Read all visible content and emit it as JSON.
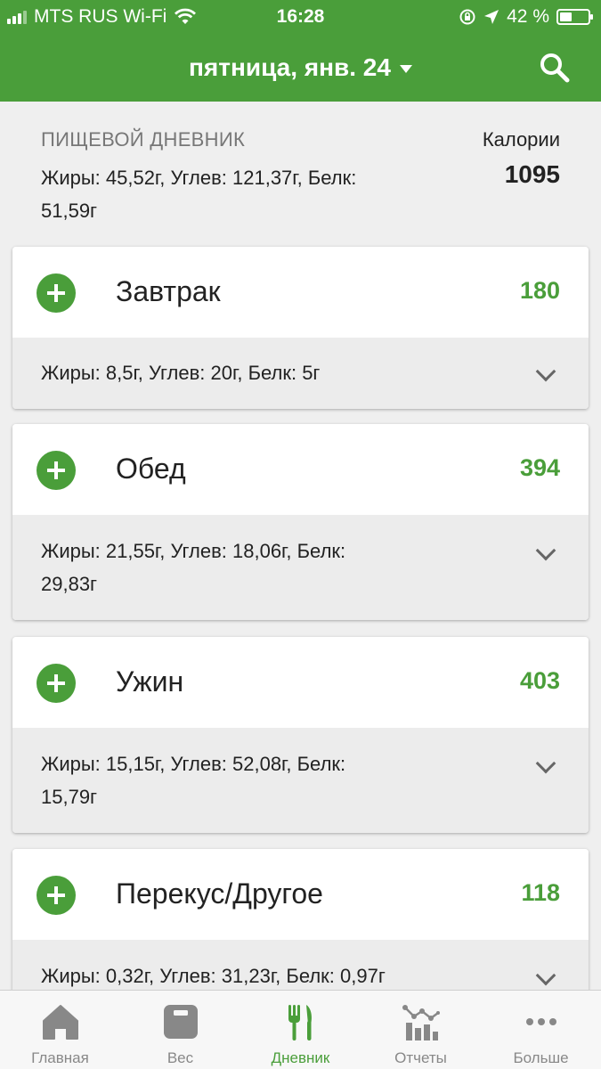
{
  "status_bar": {
    "carrier": "MTS RUS Wi-Fi",
    "time": "16:28",
    "battery_percent": "42 %",
    "battery_level": 0.42
  },
  "nav": {
    "title": "пятница, янв. 24"
  },
  "summary": {
    "label": "ПИЩЕВОЙ ДНЕВНИК",
    "macros": "Жиры: 45,52г, Углев: 121,37г, Белк: 51,59г",
    "calories_label": "Калории",
    "calories_value": "1095"
  },
  "meals": [
    {
      "name": "Завтрак",
      "calories": "180",
      "macros": "Жиры: 8,5г, Углев: 20г, Белк: 5г"
    },
    {
      "name": "Обед",
      "calories": "394",
      "macros": "Жиры: 21,55г, Углев: 18,06г, Белк: 29,83г"
    },
    {
      "name": "Ужин",
      "calories": "403",
      "macros": "Жиры: 15,15г, Углев: 52,08г, Белк: 15,79г"
    },
    {
      "name": "Перекус/Другое",
      "calories": "118",
      "macros": "Жиры: 0,32г, Углев: 31,23г, Белк: 0,97г"
    }
  ],
  "tabs": [
    {
      "label": "Главная",
      "icon": "home-icon",
      "active": false
    },
    {
      "label": "Вес",
      "icon": "scale-icon",
      "active": false
    },
    {
      "label": "Дневник",
      "icon": "fork-knife-icon",
      "active": true
    },
    {
      "label": "Отчеты",
      "icon": "chart-icon",
      "active": false
    },
    {
      "label": "Больше",
      "icon": "more-icon",
      "active": false
    }
  ],
  "colors": {
    "brand_green": "#4a9e3a",
    "inactive_tab": "#888888"
  }
}
